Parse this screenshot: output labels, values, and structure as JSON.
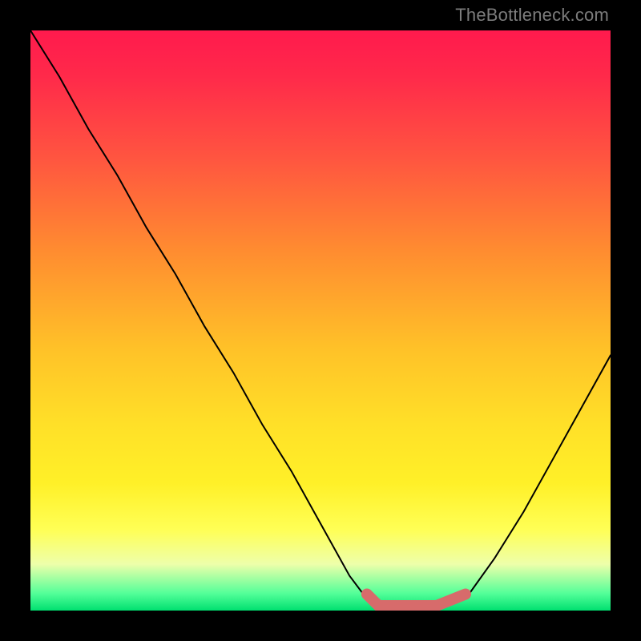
{
  "watermark": "TheBottleneck.com",
  "colors": {
    "curve": "#000000",
    "marker": "#d76b6b",
    "background": "#000000"
  },
  "chart_data": {
    "type": "line",
    "title": "",
    "xlabel": "",
    "ylabel": "",
    "xlim": [
      0,
      100
    ],
    "ylim": [
      0,
      100
    ],
    "grid": false,
    "legend": false,
    "series": [
      {
        "name": "bottleneck-curve",
        "x": [
          0,
          5,
          10,
          15,
          20,
          25,
          30,
          35,
          40,
          45,
          50,
          55,
          58,
          60,
          62,
          65,
          70,
          75,
          80,
          85,
          90,
          95,
          100
        ],
        "values": [
          100,
          92,
          83,
          75,
          66,
          58,
          49,
          41,
          32,
          24,
          15,
          6,
          2,
          0,
          0,
          0,
          0,
          2,
          9,
          17,
          26,
          35,
          44
        ]
      }
    ],
    "annotations": [
      {
        "name": "optimal-range-marker",
        "x_start": 58,
        "x_end": 75,
        "y": 0
      }
    ]
  }
}
